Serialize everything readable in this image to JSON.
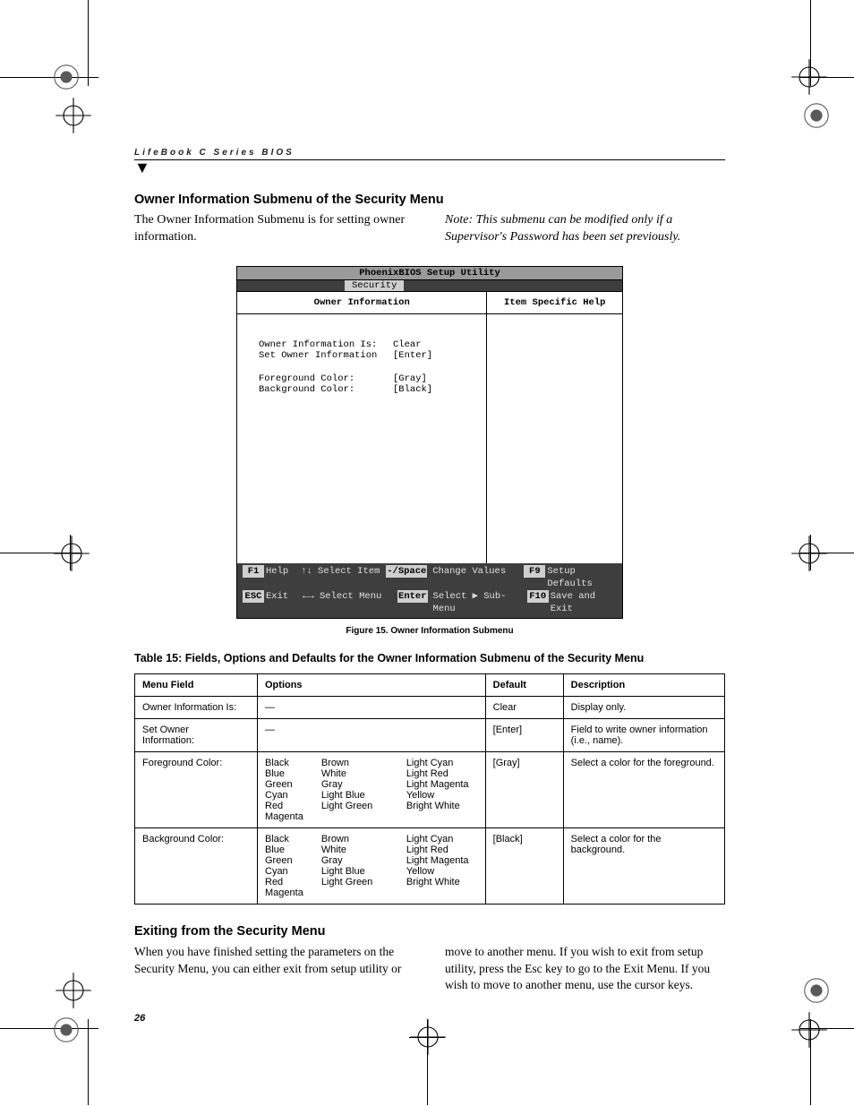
{
  "runningHead": "LifeBook C Series BIOS",
  "section1": {
    "title": "Owner Information Submenu of the Security Menu",
    "leftPara": "The Owner Information Submenu is for setting owner information.",
    "rightPara": "Note: This submenu can be modified only if a Supervisor's Password has been set previously."
  },
  "bios": {
    "title": "PhoenixBIOS Setup Utility",
    "tab": "Security",
    "leftHeader": "Owner Information",
    "rightHeader": "Item Specific Help",
    "rows": [
      {
        "label": "Owner Information Is:",
        "value": "Clear"
      },
      {
        "label": "Set Owner Information",
        "value": "[Enter]"
      }
    ],
    "rows2": [
      {
        "label": "Foreground Color:",
        "value": "[Gray]"
      },
      {
        "label": "Background Color:",
        "value": "[Black]"
      }
    ],
    "footer": {
      "r1": {
        "k1": "F1",
        "t1": "Help",
        "t2": "↑↓ Select Item",
        "k3": "-/Space",
        "t3": "Change Values",
        "k4": "F9",
        "t4": "Setup Defaults"
      },
      "r2": {
        "k1": "ESC",
        "t1": "Exit",
        "t2": "←→ Select Menu",
        "k3": "Enter",
        "t3": "Select ▶ Sub-Menu",
        "k4": "F10",
        "t4": "Save and Exit"
      }
    }
  },
  "figCaption": "Figure 15.  Owner Information Submenu",
  "tableTitle": "Table 15: Fields, Options and Defaults for the Owner Information Submenu of the Security Menu",
  "table": {
    "headers": [
      "Menu Field",
      "Options",
      "",
      "Default",
      "Description"
    ],
    "rows": [
      {
        "field": "Owner Information Is:",
        "optsA": "—",
        "optsB": "",
        "optsC": "",
        "def": "Clear",
        "desc": "Display only."
      },
      {
        "field": "Set Owner\nInformation:",
        "optsA": "—",
        "optsB": "",
        "optsC": "",
        "def": "[Enter]",
        "desc": "Field to write owner information (i.e., name)."
      },
      {
        "field": "Foreground Color:",
        "optsA": "Black\nBlue\nGreen\nCyan\nRed\nMagenta",
        "optsB": "Brown\nWhite\nGray\nLight Blue\nLight Green",
        "optsC": "Light Cyan\nLight Red\nLight Magenta\nYellow\nBright White",
        "def": "[Gray]",
        "desc": "Select a color for the foreground."
      },
      {
        "field": "Background Color:",
        "optsA": "Black\nBlue\nGreen\nCyan\nRed\nMagenta",
        "optsB": "Brown\nWhite\nGray\nLight Blue\nLight Green",
        "optsC": "Light Cyan\nLight Red\nLight Magenta\nYellow\nBright White",
        "def": "[Black]",
        "desc": "Select a color for the background."
      }
    ]
  },
  "section2": {
    "title": "Exiting from the Security Menu",
    "leftPara": "When you have finished setting the parameters on the Security Menu, you can either exit from setup utility or",
    "rightPara": "move to another menu. If you wish to exit from setup utility, press the Esc key to go to the Exit Menu. If you wish to move to another menu, use the cursor keys."
  },
  "pageNum": "26"
}
